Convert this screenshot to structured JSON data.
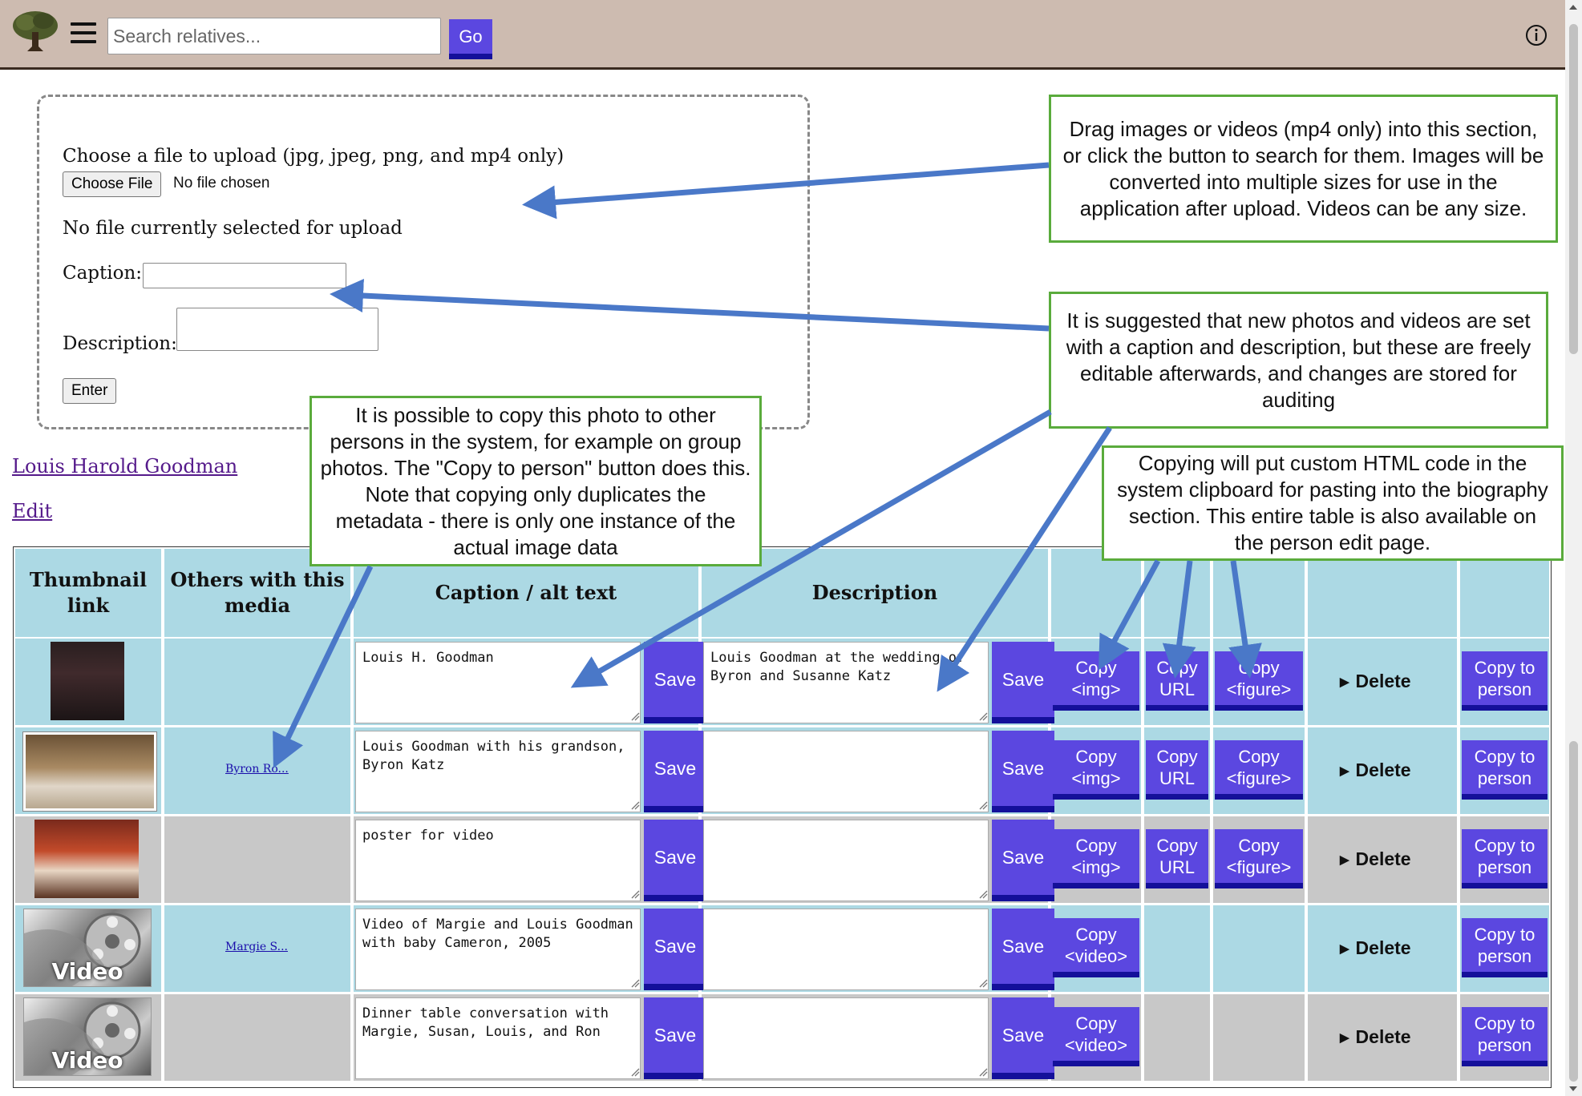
{
  "header": {
    "search_placeholder": "Search relatives...",
    "go_label": "Go"
  },
  "upload": {
    "choose_text": "Choose a file to upload (jpg, jpeg, png, and mp4 only)",
    "choose_button": "Choose File",
    "no_file_chosen": "No file chosen",
    "no_file_selected": "No file currently selected for upload",
    "caption_label": "Caption:",
    "description_label": "Description:",
    "enter_button": "Enter"
  },
  "person_link": "Louis Harold Goodman",
  "edit_link": "Edit",
  "table": {
    "headers": {
      "thumbnail": "Thumbnail link",
      "others": "Others with this media",
      "caption": "Caption / alt text",
      "description": "Description"
    },
    "save_label": "Save",
    "copy_img_label": "Copy <img>",
    "copy_url_label": "Copy URL",
    "copy_figure_label": "Copy <figure>",
    "copy_video_label": "Copy <video>",
    "delete_label": "Delete",
    "copy_person_label": "Copy to person",
    "rows": [
      {
        "caption": "Louis H. Goodman",
        "description": "Louis Goodman at the wedding of Byron and Susanne Katz",
        "others": "",
        "type": "photo"
      },
      {
        "caption": "Louis Goodman with his grandson, Byron Katz",
        "description": "",
        "others": "Byron Ro...",
        "type": "photo"
      },
      {
        "caption": "poster for video",
        "description": "",
        "others": "",
        "type": "photo"
      },
      {
        "caption": "Video of Margie and Louis Goodman with baby Cameron, 2005",
        "description": "",
        "others": "Margie S...",
        "type": "video"
      },
      {
        "caption": "Dinner table conversation with Margie, Susan, Louis, and Ron",
        "description": "",
        "others": "",
        "type": "video"
      }
    ],
    "video_thumb_label": "Video"
  },
  "callouts": {
    "drag": "Drag images or videos (mp4 only) into this section, or click the button to search for them. Images will be converted into multiple sizes for use in the application after upload.  Videos can be any size.",
    "suggested": "It is suggested that new photos and videos are set with a caption and description, but these are freely editable afterwards, and changes are stored for auditing",
    "copy_person": "It is possible to copy this photo to other persons in the system, for example on group photos. The \"Copy to person\" button does this.  Note that copying only duplicates the metadata - there is only one instance of the actual image data",
    "copying_html": "Copying will put custom HTML code in the system clipboard for pasting into the biography section.  This entire table is also available on the person edit page."
  },
  "colors": {
    "button": "#5b47e0",
    "button_shadow": "#14109a",
    "row_blue": "#acd9e4",
    "row_gray": "#c8c8c8",
    "header_bg": "#cdbbb0",
    "callout_border": "#5aab3c",
    "arrow": "#4a78c8"
  }
}
